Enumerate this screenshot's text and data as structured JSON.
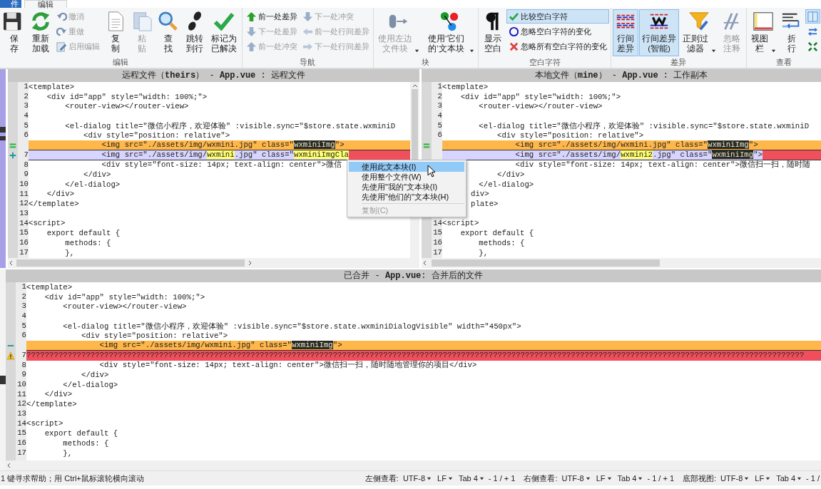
{
  "ribbon_tabs": [
    {
      "label": "件",
      "selected": false
    },
    {
      "label": "编辑",
      "selected": true
    }
  ],
  "ribbon_groups": [
    {
      "label": "编辑",
      "items": [
        {
          "kind": "large",
          "label": "保存",
          "disabled": false
        },
        {
          "kind": "large",
          "label": "重新加载",
          "disabled": false
        },
        {
          "kind": "stack",
          "items": [
            {
              "label": "撤消",
              "disabled": true
            },
            {
              "label": "重做",
              "disabled": true
            },
            {
              "label": "启用编辑",
              "disabled": true
            }
          ]
        },
        {
          "kind": "large",
          "label": "复制",
          "disabled": false
        },
        {
          "kind": "large",
          "label": "粘贴",
          "disabled": true
        },
        {
          "kind": "large",
          "label": "查找",
          "disabled": false
        },
        {
          "kind": "large",
          "label": "跳转到行",
          "disabled": false
        },
        {
          "kind": "large",
          "label": "标记为已解决",
          "disabled": false
        }
      ]
    },
    {
      "label": "导航",
      "items": [
        {
          "kind": "stack",
          "items": [
            {
              "label": "前一处差异",
              "disabled": false
            },
            {
              "label": "下一处差异",
              "disabled": true
            },
            {
              "label": "前一处冲突",
              "disabled": true
            }
          ]
        },
        {
          "kind": "stack",
          "items": [
            {
              "label": "下一处冲突",
              "disabled": true
            },
            {
              "label": "前一处行间差异",
              "disabled": true
            },
            {
              "label": "下一处行间差异",
              "disabled": true
            }
          ]
        }
      ]
    },
    {
      "label": "块",
      "items": [
        {
          "kind": "large",
          "label": "使用左边文件块",
          "menu": true,
          "disabled": true
        },
        {
          "kind": "large",
          "label": "使用‘它们的’文本块",
          "menu": true,
          "disabled": false
        }
      ]
    },
    {
      "label": "空白字符",
      "items": [
        {
          "kind": "large",
          "label": "显示空白",
          "disabled": false
        },
        {
          "kind": "stack",
          "items": [
            {
              "label": "比较空白字符",
              "selected": true,
              "disabled": false
            },
            {
              "label": "忽略空白字符的变化",
              "selected": false,
              "disabled": false
            },
            {
              "label": "忽略所有空白字符的变化",
              "selected": false,
              "disabled": false
            }
          ]
        }
      ]
    },
    {
      "label": "差异",
      "items": [
        {
          "kind": "large",
          "label": "行间差异",
          "selected": true,
          "disabled": false
        },
        {
          "kind": "large",
          "label": "行间差异(智能)",
          "selected": true,
          "disabled": false
        },
        {
          "kind": "large",
          "label": "正则过滤器",
          "menu": true,
          "selected": false,
          "disabled": false
        },
        {
          "kind": "large",
          "label": "忽略注释",
          "selected": false,
          "disabled": true
        }
      ]
    },
    {
      "label": "查看",
      "items": [
        {
          "kind": "large",
          "label": "视图栏",
          "menu": true,
          "disabled": false
        },
        {
          "kind": "large",
          "label": "折行",
          "disabled": false
        },
        {
          "kind": "stack",
          "items": [
            {
              "selected": true
            },
            {
              "selected": false
            },
            {
              "selected": false
            }
          ]
        }
      ]
    }
  ],
  "panes": [
    {
      "title": "远程文件（**theirs**） - **App.vue** : 远程文件",
      "lines": [
        {
          "number": "1",
          "text": "<template>"
        },
        {
          "number": "2",
          "text": "    <div id=\"app\" style=\"width: 100%;\">"
        },
        {
          "number": "3",
          "text": "        <router-view></router-view>"
        },
        {
          "number": "4"
        },
        {
          "number": "5",
          "text": "        <el-dialog title=\"微信小程序，欢迎体验\" :visible.sync=\"$store.state.wxminiD"
        },
        {
          "number": "6",
          "text": "            <div style=\"position: relative\">"
        },
        {
          "marker": {
            "kind": "equal"
          },
          "kind": "conflict",
          "segments": [
            {
              "text": "                <img src=\"./assets/img/wxmini.jpg\" class=\""
            },
            {
              "text": "wxminiImg",
              "kind": "dark"
            },
            {
              "text": "\">"
            }
          ]
        },
        {
          "number": "7",
          "marker": {
            "kind": "added"
          },
          "kind": "added",
          "tail": true,
          "segments": [
            {
              "text": "                <img src=\"./assets/img/"
            },
            {
              "text": "wxmini",
              "kind": "yellow"
            },
            {
              "text": ".jpg\" class=\""
            },
            {
              "text": "wxminiImgCla",
              "kind": "yellow"
            }
          ]
        },
        {
          "number": "8",
          "text": "                <div style=\"font-size: 14px; text-align: center\">微信"
        },
        {
          "number": "9",
          "text": "            </div>"
        },
        {
          "number": "10",
          "text": "        </el-dialog>"
        },
        {
          "number": "11",
          "text": "    </div>"
        },
        {
          "number": "12",
          "text": "</template>"
        },
        {
          "number": "13"
        },
        {
          "number": "14",
          "text": "<script>"
        },
        {
          "number": "15",
          "text": "    export default {"
        },
        {
          "number": "16",
          "text": "        methods: {"
        },
        {
          "number": "17",
          "text": "        },"
        }
      ]
    },
    {
      "title": "本地文件（**mine**） - **App.vue** : 工作副本",
      "lines": [
        {
          "number": "1",
          "text": "<template>"
        },
        {
          "number": "2",
          "text": "    <div id=\"app\" style=\"width: 100%;\">"
        },
        {
          "number": "3",
          "text": "        <router-view></router-view>"
        },
        {
          "number": "4"
        },
        {
          "number": "5",
          "text": "        <el-dialog title=\"微信小程序，欢迎体验\" :visible.sync=\"$store.state.wxminiD"
        },
        {
          "number": "6",
          "text": "            <div style=\"position: relative\">"
        },
        {
          "marker": {
            "kind": "equal"
          },
          "kind": "conflict",
          "segments": [
            {
              "text": "                <img src=\"./assets/img/wxmini.jpg\" class=\""
            },
            {
              "text": "wxminiImg",
              "kind": "dark"
            },
            {
              "text": "\">"
            }
          ]
        },
        {
          "kind": "added",
          "tail": true,
          "segments": [
            {
              "text": "                <img src=\"./assets/img/"
            },
            {
              "text": "wxmini2",
              "kind": "yellow"
            },
            {
              "text": ".jpg\" class=\""
            },
            {
              "text": "wxminiImg",
              "kind": "dark"
            },
            {
              "text": "\">"
            }
          ]
        },
        {
          "text": "                <div style=\"font-size: 14px; text-align: center\">微信扫一扫，随时随"
        },
        {
          "text": "            </div>"
        },
        {
          "text": "        </el-dialog>"
        },
        {
          "text": "div>",
          "covered": true
        },
        {
          "text": "plate>",
          "covered": true,
          "blank_line_after": true
        },
        {
          "number": "14",
          "text": "<script>"
        },
        {
          "number": "15",
          "text": "    export default {"
        },
        {
          "number": "16",
          "text": "        methods: {"
        },
        {
          "number": "17",
          "text": "        },"
        }
      ]
    }
  ],
  "merged_pane": {
    "title": "已合并 - **App.vue**: 合并后的文件",
    "lines": [
      {
        "number": "1",
        "text": "<template>"
      },
      {
        "number": "2",
        "text": "    <div id=\"app\" style=\"width: 100%;\">"
      },
      {
        "number": "3",
        "text": "        <router-view></router-view>"
      },
      {
        "number": "4"
      },
      {
        "number": "5",
        "text": "        <el-dialog title=\"微信小程序，欢迎体验\" :visible.sync=\"$store.state.wxminiDialogVisible\" width=\"450px\">"
      },
      {
        "number": "6",
        "text": "            <div style=\"position: relative\">"
      },
      {
        "marker": {
          "kind": "removed"
        },
        "kind": "conflict",
        "segments": [
          {
            "text": "                <img src=\"./assets/img/wxmini.jpg\" class=\""
          },
          {
            "text": "wxminiImg",
            "kind": "dark"
          },
          {
            "text": "\">"
          }
        ]
      },
      {
        "number": "7",
        "marker": {
          "kind": "warning"
        },
        "kind": "unknown",
        "text": "??????????????????????????????????????????????????????????????????????????????????????????????????????????????????????????????????????????????????????????????????????????"
      },
      {
        "number": "8",
        "text": "                <div style=\"font-size: 14px; text-align: center\">微信扫一扫，随时随地管理你的项目</div>"
      },
      {
        "number": "9",
        "text": "            </div>"
      },
      {
        "number": "10",
        "text": "        </el-dialog>"
      },
      {
        "number": "11",
        "text": "    </div>"
      },
      {
        "number": "12",
        "text": "</template>"
      },
      {
        "number": "13"
      },
      {
        "number": "14",
        "text": "<script>"
      },
      {
        "number": "15",
        "text": "    export default {"
      },
      {
        "number": "16",
        "text": "        methods: {"
      },
      {
        "number": "17",
        "text": "        },"
      }
    ]
  },
  "context_menu": {
    "items": [
      {
        "label": "使用此文本块(I)",
        "selected": true,
        "disabled": false
      },
      {
        "label": "使用整个文件(W)",
        "selected": false,
        "disabled": false
      },
      {
        "label": "先使用\"我的\"文本块(I)",
        "selected": false,
        "disabled": false
      },
      {
        "label": "先使用\"他们的\"文本块(H)",
        "selected": false,
        "disabled": false
      },
      {
        "label": "复制(C)",
        "selected": false,
        "disabled": true,
        "separator_before": true
      }
    ]
  },
  "status_bar": {
    "help": "1 键寻求帮助；用 Ctrl+鼠标滚轮横向滚动",
    "views": [
      {
        "label": "左侧查看:",
        "encoding": "UTF-8",
        "line_ending": "LF",
        "tab": "Tab 4",
        "counts": "- 1 / + 1"
      },
      {
        "label": "右侧查看:",
        "encoding": "UTF-8",
        "line_ending": "LF",
        "tab": "Tab 4",
        "counts": "- 1 / + 1"
      },
      {
        "label": "底部视图:",
        "encoding": "UTF-8",
        "line_ending": "LF",
        "tab": "Tab 4",
        "counts": "- 1 /"
      }
    ]
  }
}
